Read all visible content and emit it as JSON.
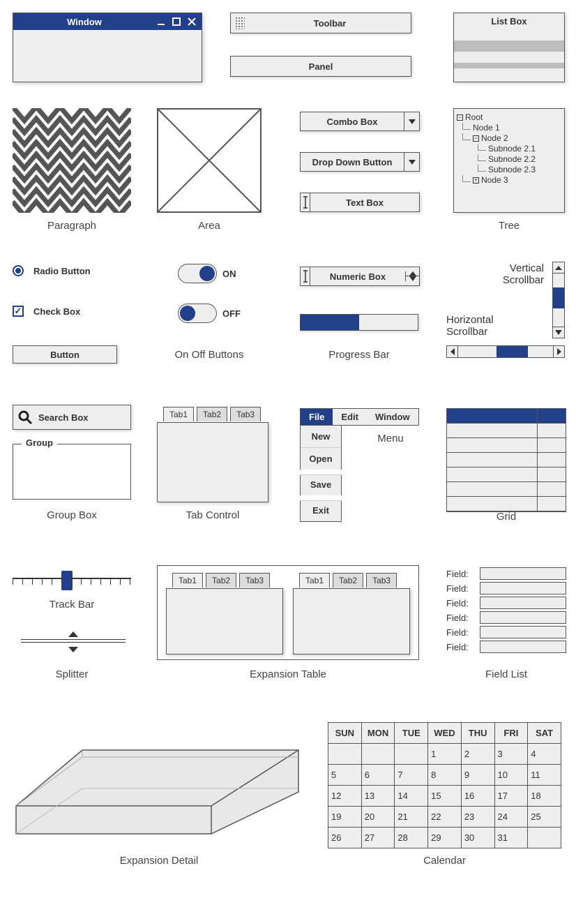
{
  "window": {
    "title": "Window"
  },
  "toolbar": {
    "label": "Toolbar"
  },
  "panel": {
    "label": "Panel"
  },
  "listbox": {
    "title": "List Box"
  },
  "paragraph": {
    "label": "Paragraph"
  },
  "area": {
    "label": "Area"
  },
  "combo": {
    "label": "Combo Box"
  },
  "dropdown_btn": {
    "label": "Drop Down Button"
  },
  "textbox": {
    "label": "Text Box"
  },
  "tree": {
    "label": "Tree",
    "root": "Root",
    "n1": "Node 1",
    "n2": "Node 2",
    "s21": "Subnode 2.1",
    "s22": "Subnode 2.2",
    "s23": "Subnode 2.3",
    "n3": "Node 3"
  },
  "radio": {
    "label": "Radio Button"
  },
  "check": {
    "label": "Check Box"
  },
  "button": {
    "label": "Button"
  },
  "toggle": {
    "on": "ON",
    "off": "OFF",
    "label": "On Off Buttons"
  },
  "numeric": {
    "label": "Numeric Box"
  },
  "progress": {
    "label": "Progress Bar"
  },
  "scroll": {
    "v": "Vertical Scrollbar",
    "h": "Horizontal Scrollbar"
  },
  "search": {
    "label": "Search Box"
  },
  "group": {
    "legend": "Group",
    "label": "Group Box"
  },
  "tabcontrol": {
    "label": "Tab Control",
    "t1": "Tab1",
    "t2": "Tab2",
    "t3": "Tab3"
  },
  "menu": {
    "label": "Menu",
    "file": "File",
    "edit": "Edit",
    "window": "Window",
    "new": "New",
    "open": "Open",
    "save": "Save",
    "exit": "Exit"
  },
  "grid": {
    "label": "Grid"
  },
  "trackbar": {
    "label": "Track Bar"
  },
  "splitter": {
    "label": "Splitter"
  },
  "exptable": {
    "label": "Expansion Table"
  },
  "fieldlist": {
    "label": "Field List",
    "flabel": "Field:"
  },
  "expdetail": {
    "label": "Expansion Detail"
  },
  "calendar": {
    "label": "Calendar",
    "days": [
      "SUN",
      "MON",
      "TUE",
      "WED",
      "THU",
      "FRI",
      "SAT"
    ],
    "weeks": [
      [
        "",
        "",
        "",
        "1",
        "2",
        "3",
        "4"
      ],
      [
        "5",
        "6",
        "7",
        "8",
        "9",
        "10",
        "11"
      ],
      [
        "12",
        "13",
        "14",
        "15",
        "16",
        "17",
        "18"
      ],
      [
        "19",
        "20",
        "21",
        "22",
        "23",
        "24",
        "25"
      ],
      [
        "26",
        "27",
        "28",
        "29",
        "30",
        "31",
        ""
      ]
    ]
  }
}
